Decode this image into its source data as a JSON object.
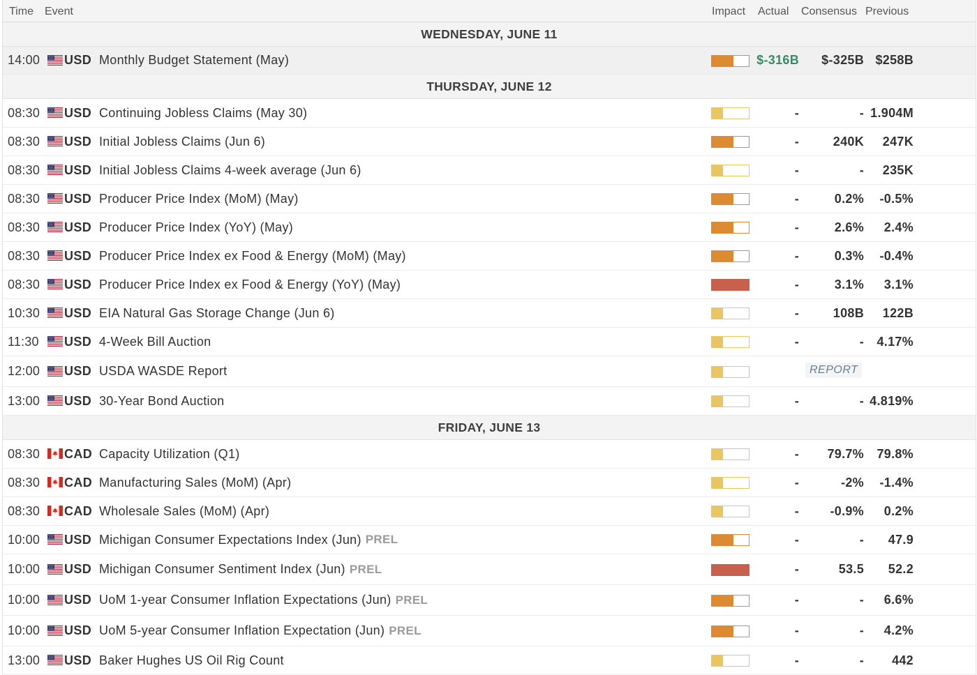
{
  "header": {
    "time": "Time",
    "event": "Event",
    "impact": "Impact",
    "actual": "Actual",
    "consensus": "Consensus",
    "previous": "Previous"
  },
  "days": [
    {
      "label": "WEDNESDAY, JUNE 11",
      "events": [
        {
          "time": "14:00",
          "flag": "us",
          "currency": "USD",
          "name": "Monthly Budget Statement (May)",
          "prel": "",
          "impact": "medium",
          "actual": "$-316B",
          "actual_color": "positive",
          "consensus": "$-325B",
          "previous": "$258B"
        }
      ]
    },
    {
      "label": "THURSDAY, JUNE 12",
      "events": [
        {
          "time": "08:30",
          "flag": "us",
          "currency": "USD",
          "name": "Continuing Jobless Claims (May 30)",
          "prel": "",
          "impact": "low",
          "actual": "-",
          "consensus": "-",
          "previous": "1.904M"
        },
        {
          "time": "08:30",
          "flag": "us",
          "currency": "USD",
          "name": "Initial Jobless Claims (Jun 6)",
          "prel": "",
          "impact": "medium",
          "actual": "-",
          "consensus": "240K",
          "previous": "247K"
        },
        {
          "time": "08:30",
          "flag": "us",
          "currency": "USD",
          "name": "Initial Jobless Claims 4-week average (Jun 6)",
          "prel": "",
          "impact": "low",
          "actual": "-",
          "consensus": "-",
          "previous": "235K"
        },
        {
          "time": "08:30",
          "flag": "us",
          "currency": "USD",
          "name": "Producer Price Index (MoM) (May)",
          "prel": "",
          "impact": "medium",
          "actual": "-",
          "consensus": "0.2%",
          "previous": "-0.5%"
        },
        {
          "time": "08:30",
          "flag": "us",
          "currency": "USD",
          "name": "Producer Price Index (YoY) (May)",
          "prel": "",
          "impact": "medium",
          "actual": "-",
          "consensus": "2.6%",
          "previous": "2.4%"
        },
        {
          "time": "08:30",
          "flag": "us",
          "currency": "USD",
          "name": "Producer Price Index ex Food & Energy (MoM) (May)",
          "prel": "",
          "impact": "medium",
          "actual": "-",
          "consensus": "0.3%",
          "previous": "-0.4%"
        },
        {
          "time": "08:30",
          "flag": "us",
          "currency": "USD",
          "name": "Producer Price Index ex Food & Energy (YoY) (May)",
          "prel": "",
          "impact": "high",
          "actual": "-",
          "consensus": "3.1%",
          "previous": "3.1%"
        },
        {
          "time": "10:30",
          "flag": "us",
          "currency": "USD",
          "name": "EIA Natural Gas Storage Change (Jun 6)",
          "prel": "",
          "impact": "low",
          "actual": "-",
          "consensus": "108B",
          "previous": "122B"
        },
        {
          "time": "11:30",
          "flag": "us",
          "currency": "USD",
          "name": "4-Week Bill Auction",
          "prel": "",
          "impact": "low",
          "actual": "-",
          "consensus": "-",
          "previous": "4.17%"
        },
        {
          "time": "12:00",
          "flag": "us",
          "currency": "USD",
          "name": "USDA WASDE Report",
          "prel": "",
          "impact": "low",
          "report": "REPORT",
          "actual": "",
          "consensus": "",
          "previous": "",
          "tall": true
        },
        {
          "time": "13:00",
          "flag": "us",
          "currency": "USD",
          "name": "30-Year Bond Auction",
          "prel": "",
          "impact": "low",
          "actual": "-",
          "consensus": "-",
          "previous": "4.819%"
        }
      ]
    },
    {
      "label": "FRIDAY, JUNE 13",
      "events": [
        {
          "time": "08:30",
          "flag": "ca",
          "currency": "CAD",
          "name": "Capacity Utilization (Q1)",
          "prel": "",
          "impact": "low",
          "actual": "-",
          "consensus": "79.7%",
          "previous": "79.8%"
        },
        {
          "time": "08:30",
          "flag": "ca",
          "currency": "CAD",
          "name": "Manufacturing Sales (MoM) (Apr)",
          "prel": "",
          "impact": "low",
          "actual": "-",
          "consensus": "-2%",
          "previous": "-1.4%"
        },
        {
          "time": "08:30",
          "flag": "ca",
          "currency": "CAD",
          "name": "Wholesale Sales (MoM) (Apr)",
          "prel": "",
          "impact": "low",
          "actual": "-",
          "consensus": "-0.9%",
          "previous": "0.2%"
        },
        {
          "time": "10:00",
          "flag": "us",
          "currency": "USD",
          "name": "Michigan Consumer Expectations Index (Jun)",
          "prel": "PREL",
          "impact": "medium",
          "actual": "-",
          "consensus": "-",
          "previous": "47.9"
        },
        {
          "time": "10:00",
          "flag": "us",
          "currency": "USD",
          "name": "Michigan Consumer Sentiment Index (Jun)",
          "prel": "PREL",
          "impact": "high",
          "actual": "-",
          "consensus": "53.5",
          "previous": "52.2",
          "tall": true
        },
        {
          "time": "10:00",
          "flag": "us",
          "currency": "USD",
          "name": "UoM 1-year Consumer Inflation Expectations (Jun)",
          "prel": "PREL",
          "impact": "medium",
          "actual": "-",
          "consensus": "-",
          "previous": "6.6%",
          "tall": true
        },
        {
          "time": "10:00",
          "flag": "us",
          "currency": "USD",
          "name": "UoM 5-year Consumer Inflation Expectation (Jun)",
          "prel": "PREL",
          "impact": "medium",
          "actual": "-",
          "consensus": "-",
          "previous": "4.2%",
          "tall": true
        },
        {
          "time": "13:00",
          "flag": "us",
          "currency": "USD",
          "name": "Baker Hughes US Oil Rig Count",
          "prel": "",
          "impact": "low",
          "actual": "-",
          "consensus": "-",
          "previous": "442"
        }
      ]
    }
  ],
  "colors": {
    "impact_low": "#e9c661",
    "impact_medium": "#dd8b32",
    "impact_high": "#c9604b",
    "actual_positive": "#3a8a6a"
  }
}
